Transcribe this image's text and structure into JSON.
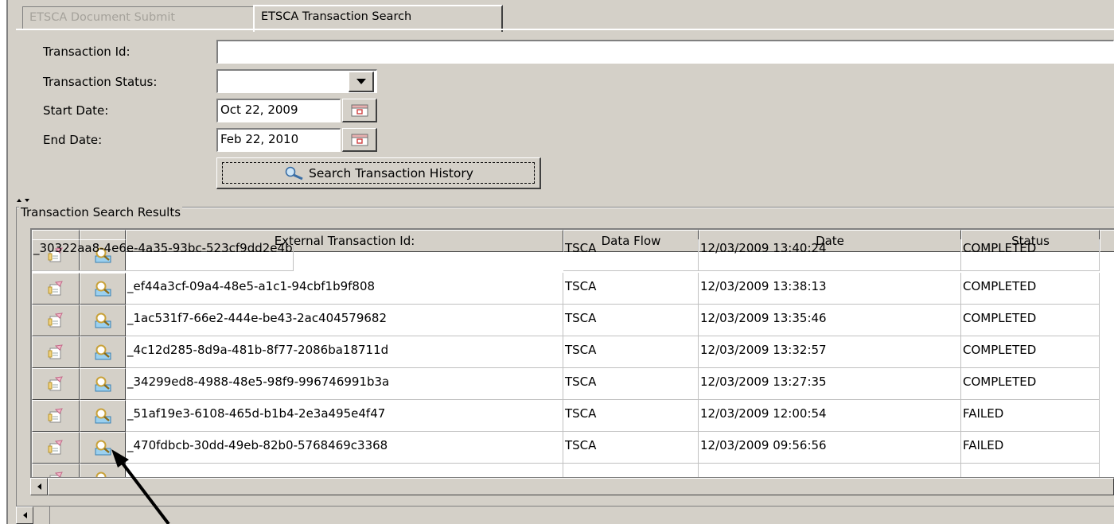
{
  "tabs": [
    {
      "label": "ETSCA Document Submit",
      "active": false
    },
    {
      "label": "ETSCA Transaction Search",
      "active": true
    }
  ],
  "form": {
    "transaction_id_label": "Transaction Id:",
    "transaction_id_value": "",
    "transaction_status_label": "Transaction Status:",
    "transaction_status_value": "",
    "start_date_label": "Start Date:",
    "start_date_value": "Oct 22, 2009",
    "end_date_label": "End Date:",
    "end_date_value": "Feb 22, 2010",
    "search_button_label": "Search Transaction History"
  },
  "results": {
    "group_title": "Transaction Search Results",
    "columns": [
      "....",
      "....",
      "External Transaction Id:",
      "Data Flow",
      "Date",
      "Status"
    ],
    "rows": [
      {
        "id": "_30322aa8-4e6e-4a35-93bc-523cf9dd2e4b",
        "flow": "TSCA",
        "date": "12/03/2009 13:40:24",
        "status": "COMPLETED"
      },
      {
        "id": "_ef44a3cf-09a4-48e5-a1c1-94cbf1b9f808",
        "flow": "TSCA",
        "date": "12/03/2009 13:38:13",
        "status": "COMPLETED"
      },
      {
        "id": "_1ac531f7-66e2-444e-be43-2ac404579682",
        "flow": "TSCA",
        "date": "12/03/2009 13:35:46",
        "status": "COMPLETED"
      },
      {
        "id": "_4c12d285-8d9a-481b-8f77-2086ba18711d",
        "flow": "TSCA",
        "date": "12/03/2009 13:32:57",
        "status": "COMPLETED"
      },
      {
        "id": "_34299ed8-4988-48e5-98f9-996746991b3a",
        "flow": "TSCA",
        "date": "12/03/2009 13:27:35",
        "status": "COMPLETED"
      },
      {
        "id": "_51af19e3-6108-465d-b1b4-2e3a495e4f47",
        "flow": "TSCA",
        "date": "12/03/2009 12:00:54",
        "status": "FAILED"
      },
      {
        "id": "_470fdbcb-30dd-49eb-82b0-5768469c3368",
        "flow": "TSCA",
        "date": "12/03/2009 09:56:56",
        "status": "FAILED"
      }
    ]
  },
  "icons": {
    "row_action_1": "document-edit-icon",
    "row_action_2": "magnifier-view-icon",
    "search_button_icon": "magnifier-icon",
    "calendar_icon": "calendar-icon"
  },
  "colors": {
    "panel_bg": "#d4d0c8",
    "field_bg": "#ffffff",
    "inactive_tab_text": "#a5a29b"
  }
}
